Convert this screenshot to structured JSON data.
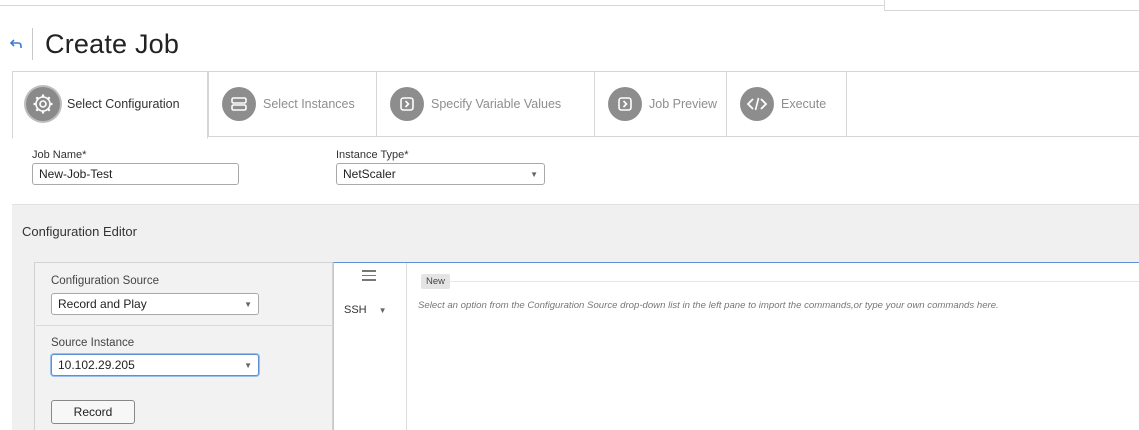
{
  "page": {
    "title": "Create Job"
  },
  "wizard": {
    "steps": [
      {
        "label": "Select Configuration",
        "icon": "gear-icon",
        "active": true
      },
      {
        "label": "Select Instances",
        "icon": "server-icon",
        "active": false
      },
      {
        "label": "Specify Variable Values",
        "icon": "chevron-box-icon",
        "active": false
      },
      {
        "label": "Job Preview",
        "icon": "chevron-box-icon",
        "active": false
      },
      {
        "label": "Execute",
        "icon": "code-icon",
        "active": false
      }
    ]
  },
  "form": {
    "job_name_label": "Job Name*",
    "job_name_value": "New-Job-Test",
    "instance_type_label": "Instance Type*",
    "instance_type_value": "NetScaler"
  },
  "editor": {
    "heading": "Configuration Editor",
    "config_source_label": "Configuration Source",
    "config_source_value": "Record and Play",
    "source_instance_label": "Source Instance",
    "source_instance_value": "10.102.29.205",
    "record_button": "Record",
    "protocol_value": "SSH",
    "new_badge": "New",
    "placeholder": "Select an option from the Configuration Source drop-down list in the left pane to import the commands,or type your own commands here."
  },
  "colors": {
    "accent": "#5b8fd6",
    "icon_gray": "#8d8d8d",
    "panel_bg": "#f0f0f0"
  }
}
